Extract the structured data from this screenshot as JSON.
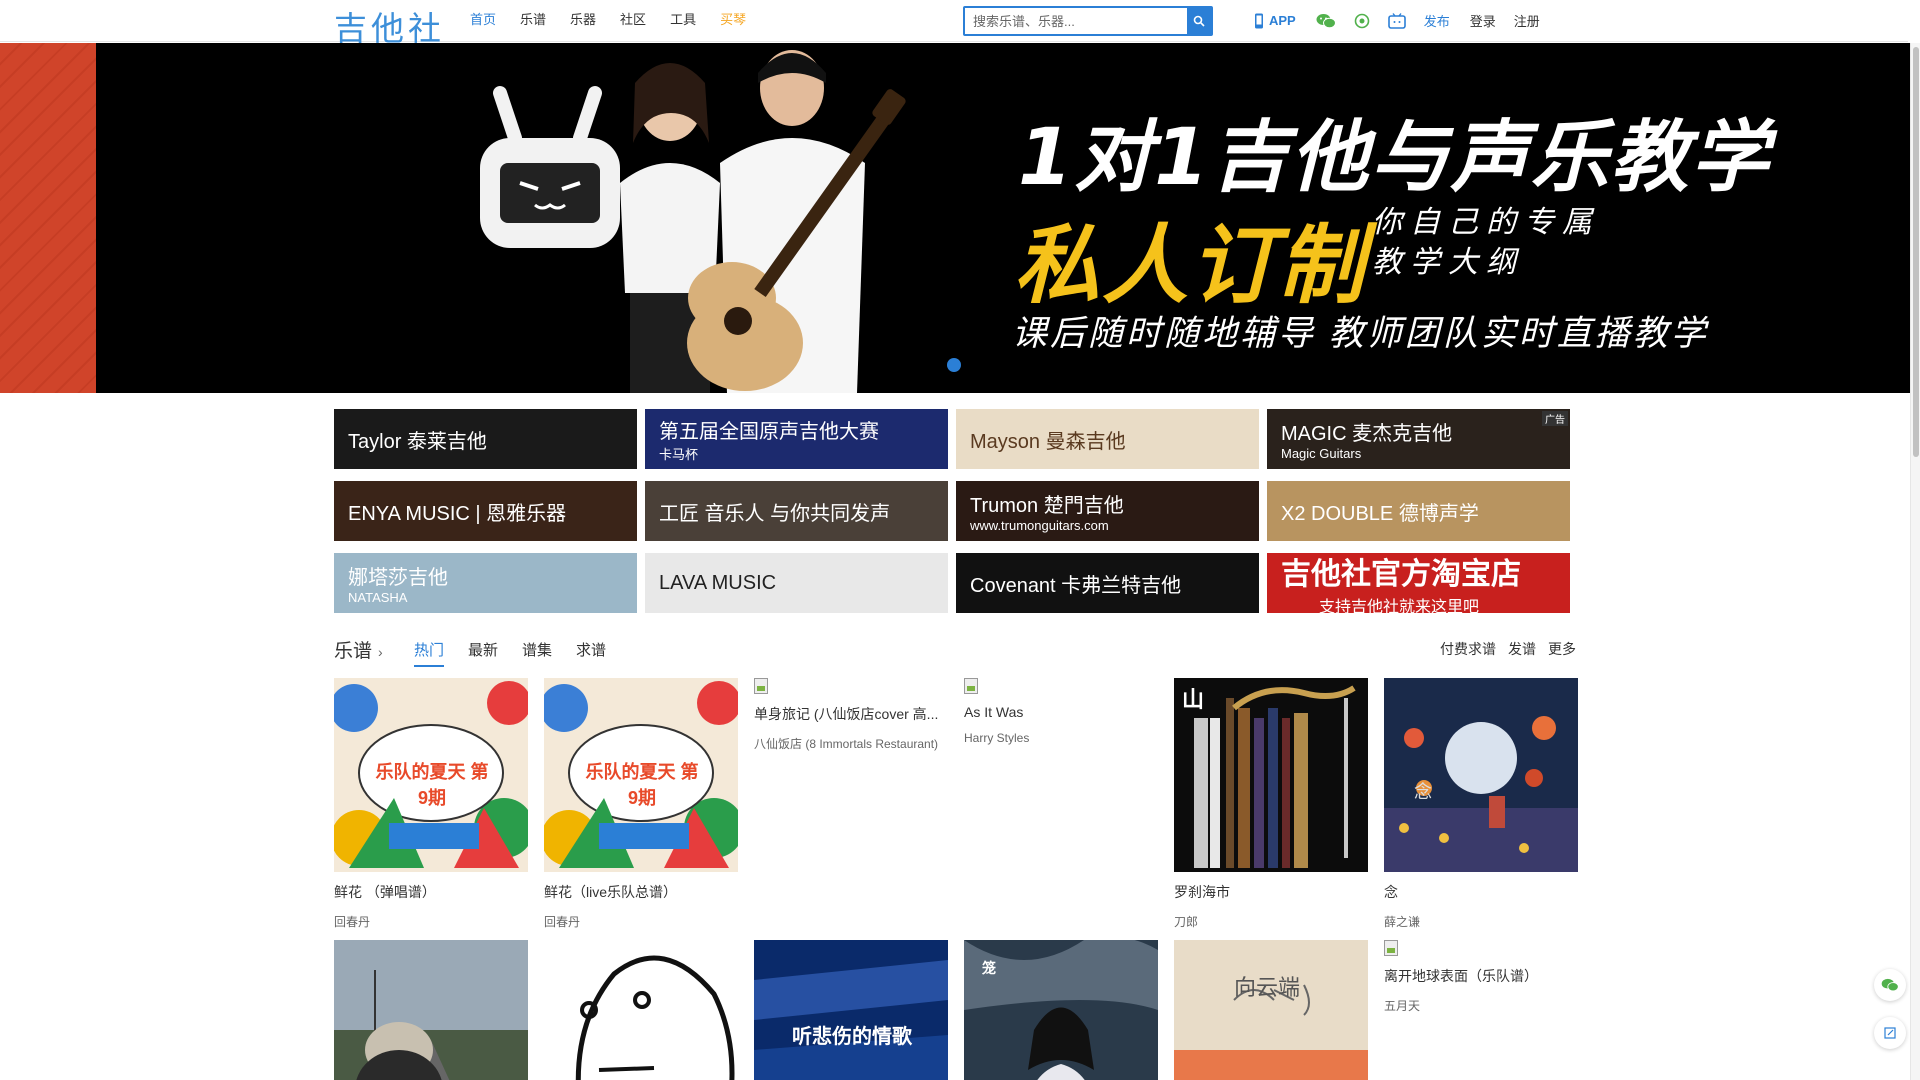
{
  "header": {
    "logo": "吉他社",
    "nav": [
      {
        "label": "首页",
        "style": "active"
      },
      {
        "label": "乐谱",
        "style": ""
      },
      {
        "label": "乐器",
        "style": ""
      },
      {
        "label": "社区",
        "style": ""
      },
      {
        "label": "工具",
        "style": ""
      },
      {
        "label": "买琴",
        "style": "orange"
      }
    ],
    "search_placeholder": "搜索乐谱、乐器...",
    "app_label": "APP",
    "publish_label": "发布",
    "login_label": "登录",
    "register_label": "注册"
  },
  "banner": {
    "line1": "1对1吉他与声乐教学",
    "line2": "私人订制",
    "line2b_1": "你自己的专属",
    "line2b_2": "教学大纲",
    "line3": "课后随时随地辅导 教师团队实时直播教学"
  },
  "ads": [
    {
      "text": "Taylor 泰莱吉他",
      "sub": "",
      "bg": "#1a1a1a",
      "badge": ""
    },
    {
      "text": "第五届全国原声吉他大赛",
      "sub": "卡马杯",
      "bg": "#1c2a6e",
      "badge": ""
    },
    {
      "text": "Mayson 曼森吉他",
      "sub": "",
      "bg": "#e9dcc6",
      "badge": ""
    },
    {
      "text": "MAGIC 麦杰克吉他",
      "sub": "Magic Guitars",
      "bg": "#2a221c",
      "badge": "广告"
    },
    {
      "text": "ENYA MUSIC | 恩雅乐器",
      "sub": "",
      "bg": "#3a2418",
      "badge": ""
    },
    {
      "text": "工匠 音乐人 与你共同发声",
      "sub": "",
      "bg": "#4a4038",
      "badge": ""
    },
    {
      "text": "Trumon 楚門吉他",
      "sub": "www.trumonguitars.com",
      "bg": "#2a1a14",
      "badge": ""
    },
    {
      "text": "X2 DOUBLE 德博声学",
      "sub": "",
      "bg": "#b89460",
      "badge": ""
    },
    {
      "text": "娜塔莎吉他",
      "sub": "NATASHA",
      "bg": "#9bb7c8",
      "badge": ""
    },
    {
      "text": "LAVA MUSIC",
      "sub": "",
      "bg": "#e8e8e8",
      "badge": ""
    },
    {
      "text": "Covenant 卡弗兰特吉他",
      "sub": "",
      "bg": "#111111",
      "badge": ""
    },
    {
      "text": "吉他社官方淘宝店",
      "sub": "支持吉他社就来这里吧",
      "bg": "#c8201e",
      "badge": ""
    }
  ],
  "section": {
    "title": "乐谱",
    "tabs": [
      "热门",
      "最新",
      "谱集",
      "求谱"
    ],
    "right_links": [
      "付费求谱",
      "发谱",
      "更多"
    ]
  },
  "cards": [
    {
      "title": "鲜花 （弹唱谱）",
      "artist": "回春丹",
      "img": "summer",
      "thumb_text": "乐队的夏天 第9期"
    },
    {
      "title": "鲜花（live乐队总谱）",
      "artist": "回春丹",
      "img": "summer",
      "thumb_text": "乐队的夏天 第9期"
    },
    {
      "title": "单身旅记 (八仙饭店cover 高...",
      "artist": "八仙饭店 (8 Immortals Restaurant)",
      "img": "none",
      "thumb_text": ""
    },
    {
      "title": "As It Was",
      "artist": "Harry Styles",
      "img": "none",
      "thumb_text": ""
    },
    {
      "title": "罗刹海市",
      "artist": "刀郎",
      "img": "luosha",
      "thumb_text": "山"
    },
    {
      "title": "念",
      "artist": "薛之谦",
      "img": "nian",
      "thumb_text": "念"
    },
    {
      "title": "",
      "artist": "",
      "img": "road",
      "thumb_text": ""
    },
    {
      "title": "",
      "artist": "",
      "img": "face",
      "thumb_text": ""
    },
    {
      "title": "",
      "artist": "",
      "img": "blue",
      "thumb_text": "听悲伤的情歌"
    },
    {
      "title": "",
      "artist": "",
      "img": "girl",
      "thumb_text": "笼"
    },
    {
      "title": "",
      "artist": "",
      "img": "sunset",
      "thumb_text": "向云端"
    },
    {
      "title": "离开地球表面（乐队谱）",
      "artist": "五月天",
      "img": "none",
      "thumb_text": ""
    }
  ]
}
